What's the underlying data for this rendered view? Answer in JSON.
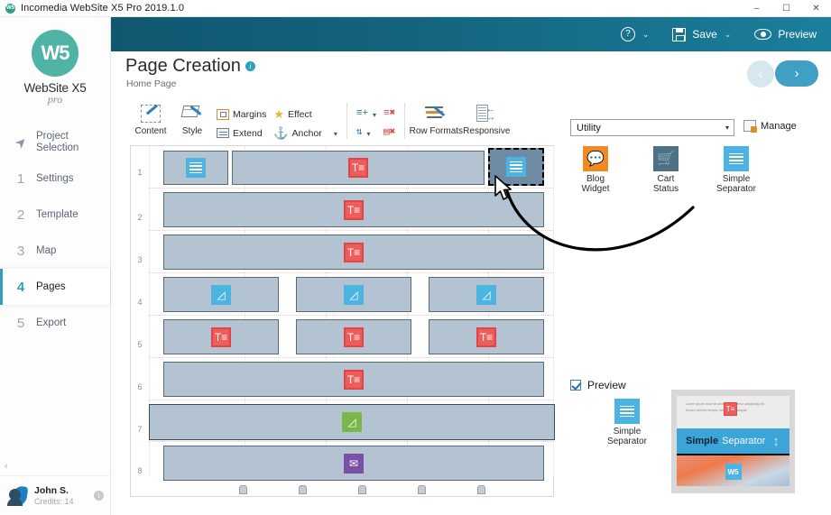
{
  "window": {
    "title": "Incomedia WebSite X5 Pro 2019.1.0",
    "app_icon": "w5-app-icon",
    "minimize": "–",
    "maximize": "☐",
    "close": "✕"
  },
  "sidebar": {
    "logo_mark": "W5",
    "logo_name": "WebSite X5",
    "logo_sub": "pro",
    "items": [
      {
        "num": "",
        "icon": "rocket-icon",
        "label": "Project\nSelection",
        "line1": "Project",
        "line2": "Selection",
        "active": false
      },
      {
        "num": "1",
        "label": "Settings",
        "active": false
      },
      {
        "num": "2",
        "label": "Template",
        "active": false
      },
      {
        "num": "3",
        "label": "Map",
        "active": false
      },
      {
        "num": "4",
        "label": "Pages",
        "active": true
      },
      {
        "num": "5",
        "label": "Export",
        "active": false
      }
    ],
    "collapse_icon": "‹",
    "user": {
      "name": "John S.",
      "credits": "Credits: 14",
      "info_icon": "i"
    }
  },
  "topbar": {
    "help_label": "",
    "help_icon": "question-circle-icon",
    "help_caret": "⌄",
    "save_label": "Save",
    "save_icon": "floppy-disk-icon",
    "save_caret": "⌄",
    "preview_label": "Preview",
    "preview_icon": "eye-icon"
  },
  "page_header": {
    "title": "Page Creation",
    "info_icon": "i",
    "breadcrumb": "Home Page",
    "prev_icon": "‹",
    "next_icon": "›"
  },
  "ribbon": {
    "content_label": "Content",
    "style_label": "Style",
    "margins_label": "Margins",
    "extend_label": "Extend",
    "effect_label": "Effect",
    "anchor_label": "Anchor",
    "anchor_caret": "▾",
    "row_add_caret": "▾",
    "row_move_caret": "▾",
    "row_formats_label": "Row Formats",
    "responsive_label": "Responsive"
  },
  "right_panel": {
    "category_value": "Utility",
    "category_caret": "▾",
    "manage_label": "Manage",
    "widgets": [
      {
        "name": "Blog Widget",
        "line1": "Blog",
        "line2": "Widget",
        "color": "#ef8b22",
        "icon": "blog-bubble-icon"
      },
      {
        "name": "Cart Status",
        "line1": "Cart",
        "line2": "Status",
        "color": "#4f7185",
        "icon": "cart-check-icon"
      },
      {
        "name": "Simple Separator",
        "line1": "Simple",
        "line2": "Separator",
        "color": "#4db3e0",
        "icon": "separator-lines-icon"
      }
    ],
    "preview_checkbox_label": "Preview",
    "preview_checked": true,
    "preview_widget": {
      "line1": "Simple",
      "line2": "Separator",
      "color": "#4db3e0"
    },
    "thumbnail": {
      "lorem_line1": "Lorem ipsum dolor sit amet, consectetur adipiscing elit.",
      "lorem_line2": "Donec ultricies tempor dolor eu consequat.",
      "band_bold": "Simple",
      "band_regular": "Separator",
      "band_arrow": "↕",
      "logo_mark": "W5"
    }
  },
  "canvas": {
    "row_numbers": [
      "1",
      "2",
      "3",
      "4",
      "5",
      "6",
      "7",
      "8"
    ],
    "rows": [
      {
        "num": "1",
        "cells": [
          {
            "span": 1,
            "type": "separator",
            "icon": "separator-lines-icon",
            "selected": false
          },
          {
            "span": 3,
            "type": "text",
            "icon": "text-icon",
            "selected": false
          },
          {
            "span": 1,
            "type": "separator",
            "icon": "separator-lines-icon",
            "selected": true
          }
        ]
      },
      {
        "num": "2",
        "cells": [
          {
            "span": 5,
            "type": "text",
            "icon": "text-icon",
            "selected": false
          }
        ]
      },
      {
        "num": "3",
        "cells": [
          {
            "span": 5,
            "type": "text",
            "icon": "text-icon",
            "selected": false
          }
        ]
      },
      {
        "num": "4",
        "cells": [
          {
            "span": 1.67,
            "type": "image",
            "icon": "image-icon",
            "selected": false
          },
          {
            "span": 1.67,
            "type": "image",
            "icon": "image-icon",
            "selected": false
          },
          {
            "span": 1.67,
            "type": "image",
            "icon": "image-icon",
            "selected": false
          }
        ]
      },
      {
        "num": "5",
        "cells": [
          {
            "span": 1.67,
            "type": "text",
            "icon": "text-icon",
            "selected": false
          },
          {
            "span": 1.67,
            "type": "text",
            "icon": "text-icon",
            "selected": false
          },
          {
            "span": 1.67,
            "type": "text",
            "icon": "text-icon",
            "selected": false
          }
        ]
      },
      {
        "num": "6",
        "cells": [
          {
            "span": 5,
            "type": "text",
            "icon": "text-icon",
            "selected": false
          }
        ]
      },
      {
        "num": "7",
        "cells": [
          {
            "span": 5,
            "type": "gallery",
            "icon": "gallery-icon",
            "selected": false,
            "full": true
          }
        ]
      },
      {
        "num": "8",
        "cells": [
          {
            "span": 5,
            "type": "email",
            "icon": "email-icon",
            "selected": false
          }
        ]
      }
    ],
    "anchor_count": 5,
    "anchor_icon": "anchor-marker-icon"
  },
  "colors": {
    "brand_teal": "#14637c",
    "accent_blue": "#2e9fbf",
    "cell_fill": "#b3c3d1",
    "cell_selected": "#6f8ba4",
    "text_widget": "#ef5c5c",
    "image_widget": "#4db3e0",
    "gallery_widget": "#7ab648",
    "email_widget": "#7b4ea8",
    "blog_widget": "#ef8b22",
    "cart_widget": "#4f7185"
  }
}
